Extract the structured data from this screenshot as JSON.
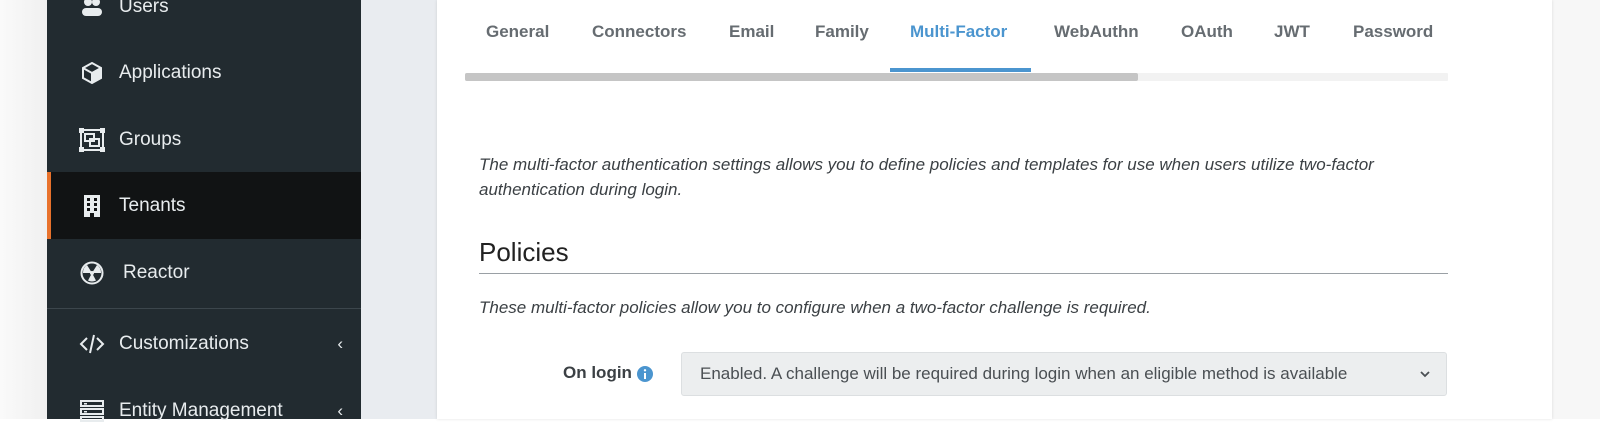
{
  "sidebar": {
    "items": [
      {
        "label": "Users",
        "icon": "users-icon"
      },
      {
        "label": "Applications",
        "icon": "cube-icon"
      },
      {
        "label": "Groups",
        "icon": "object-group-icon"
      },
      {
        "label": "Tenants",
        "icon": "building-icon",
        "active": true
      },
      {
        "label": "Reactor",
        "icon": "radiation-icon"
      },
      {
        "label": "Customizations",
        "icon": "code-icon",
        "chevron": "‹"
      },
      {
        "label": "Entity Management",
        "icon": "server-icon",
        "chevron": "‹"
      }
    ],
    "accent_color": "#e8722c"
  },
  "tabs": [
    {
      "label": "General"
    },
    {
      "label": "Connectors"
    },
    {
      "label": "Email"
    },
    {
      "label": "Family"
    },
    {
      "label": "Multi-Factor",
      "active": true
    },
    {
      "label": "WebAuthn"
    },
    {
      "label": "OAuth"
    },
    {
      "label": "JWT"
    },
    {
      "label": "Password"
    }
  ],
  "tab_active_color": "#4b95cf",
  "content": {
    "description": "The multi-factor authentication settings allows you to define policies and templates for use when users utilize two-factor authentication during login.",
    "policies_title": "Policies",
    "policies_description": "These multi-factor policies allow you to configure when a two-factor challenge is required.",
    "on_login_label": "On login",
    "on_login_value": "Enabled. A challenge will be required during login when an eligible method is available"
  }
}
